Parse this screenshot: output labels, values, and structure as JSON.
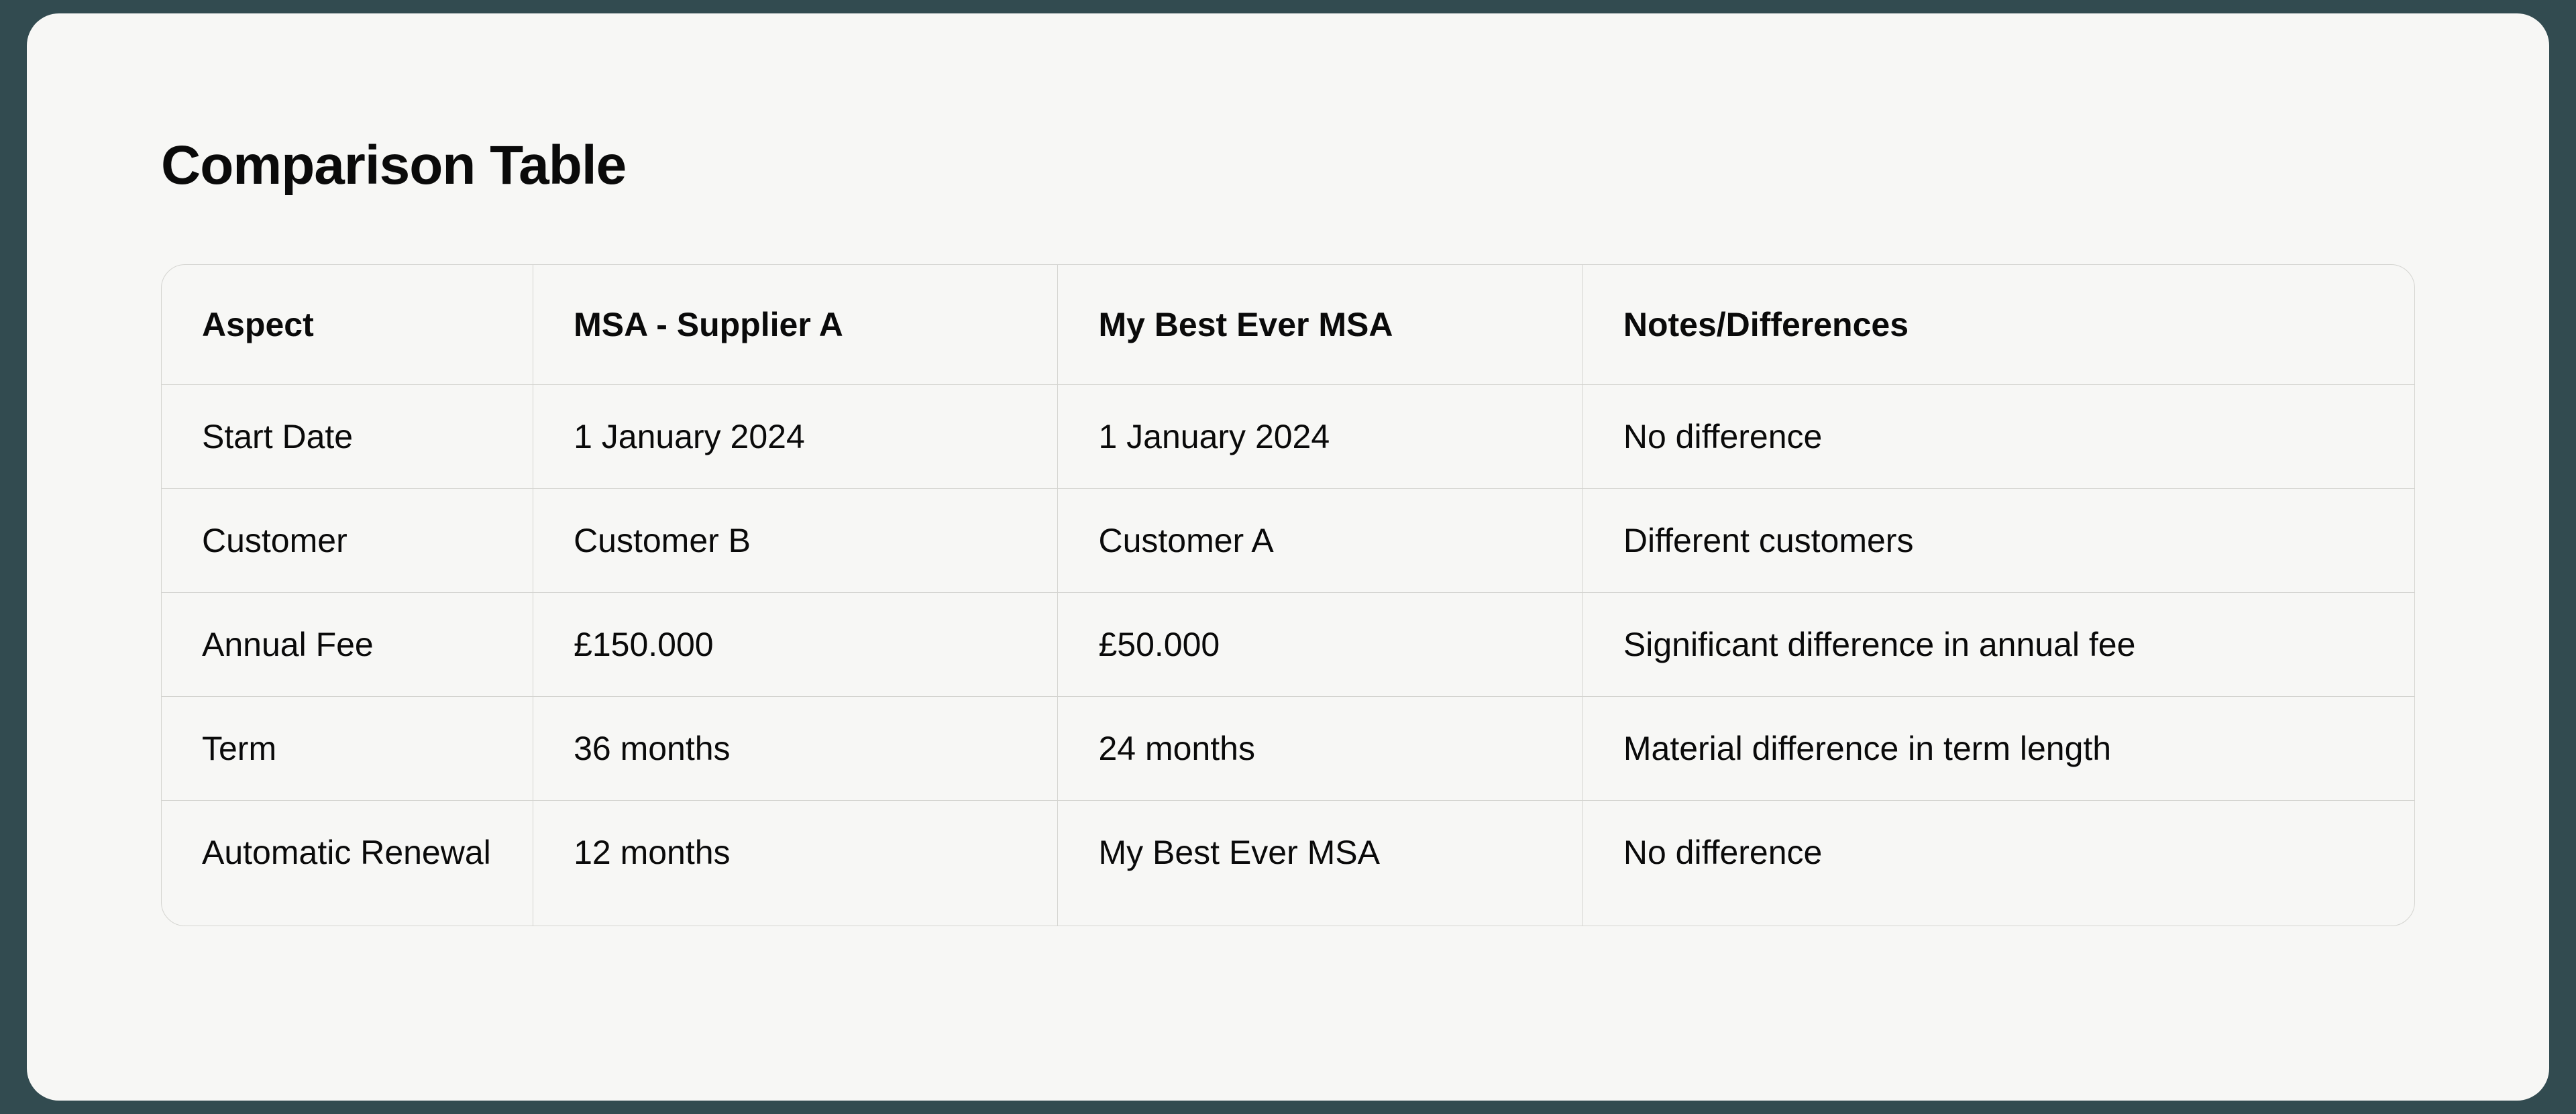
{
  "title": "Comparison Table",
  "headers": {
    "aspect": "Aspect",
    "msa_supplier_a": "MSA - Supplier A",
    "my_best_ever_msa": "My Best Ever MSA",
    "notes": "Notes/Differences"
  },
  "rows": [
    {
      "aspect": "Start Date",
      "msa_supplier_a": "1 January 2024",
      "my_best_ever_msa": "1 January 2024",
      "notes": "No difference"
    },
    {
      "aspect": "Customer",
      "msa_supplier_a": "Customer B",
      "my_best_ever_msa": "Customer A",
      "notes": "Different customers"
    },
    {
      "aspect": "Annual Fee",
      "msa_supplier_a": "£150.000",
      "my_best_ever_msa": "£50.000",
      "notes": "Significant difference in annual fee"
    },
    {
      "aspect": "Term",
      "msa_supplier_a": "36 months",
      "my_best_ever_msa": "24 months",
      "notes": "Material difference in term length"
    },
    {
      "aspect": "Automatic Renewal",
      "msa_supplier_a": "12 months",
      "my_best_ever_msa": "My Best Ever MSA",
      "notes": "No difference"
    }
  ]
}
